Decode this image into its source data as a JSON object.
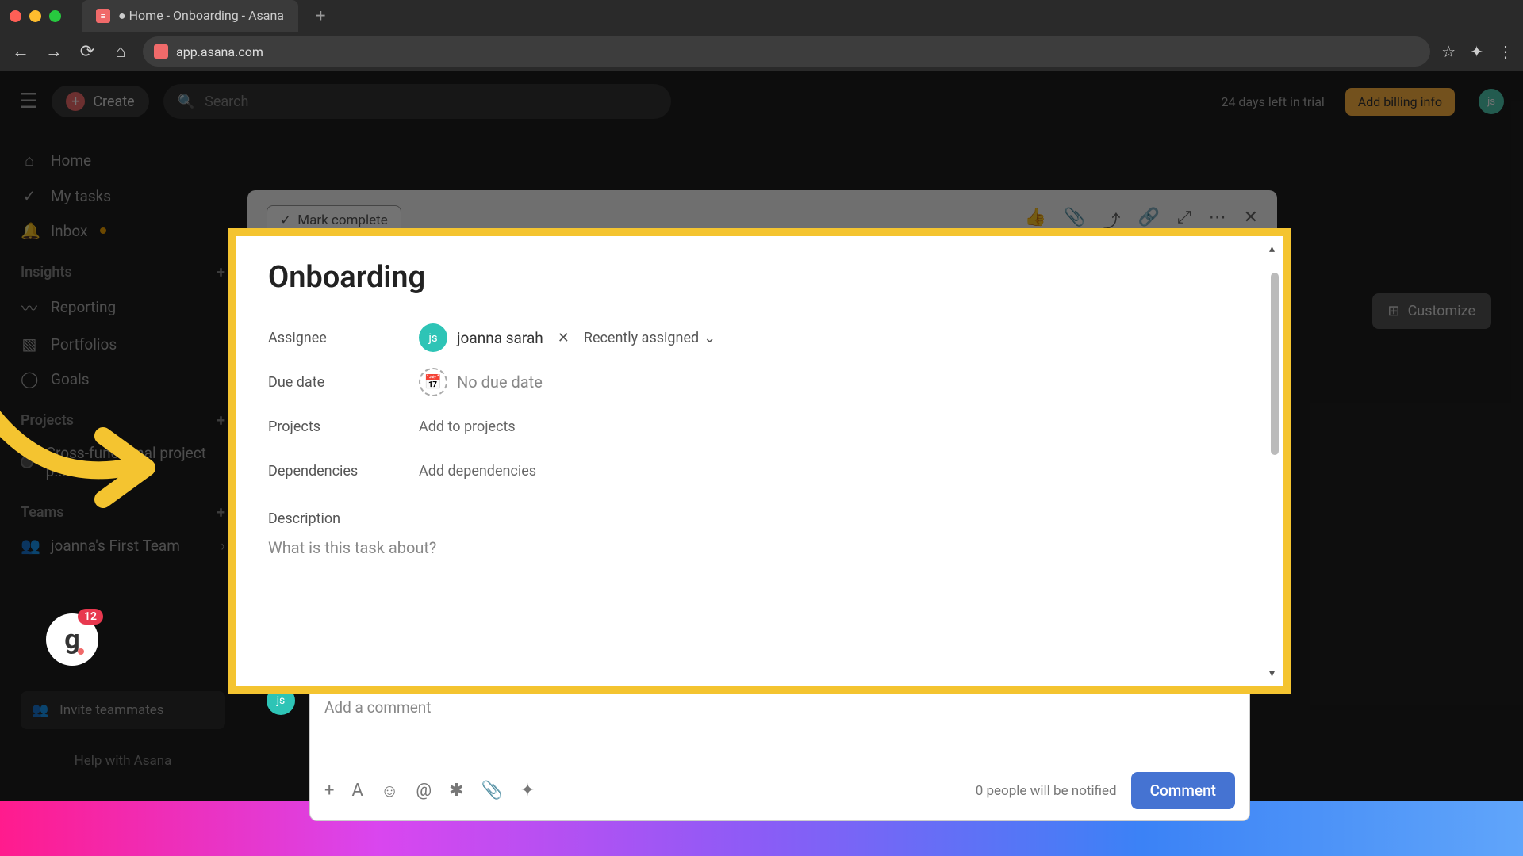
{
  "browser": {
    "tab_title": "● Home - Onboarding - Asana",
    "url": "app.asana.com"
  },
  "topbar": {
    "create": "Create",
    "search_placeholder": "Search",
    "trial": "24 days left in trial",
    "billing": "Add billing info"
  },
  "sidebar": {
    "home": "Home",
    "mytasks": "My tasks",
    "inbox": "Inbox",
    "insights": "Insights",
    "reporting": "Reporting",
    "portfolios": "Portfolios",
    "goals": "Goals",
    "projects_header": "Projects",
    "project1": "Cross-functional project p...",
    "teams_header": "Teams",
    "team1": "joanna's First Team",
    "invite": "Invite teammates",
    "help": "Help with Asana",
    "g_badge_count": "12"
  },
  "customize": "Customize",
  "task_panel": {
    "mark_complete": "Mark complete"
  },
  "modal": {
    "title": "Onboarding",
    "assignee_label": "Assignee",
    "assignee_initials": "js",
    "assignee_name": "joanna sarah",
    "recently_assigned": "Recently assigned",
    "due_label": "Due date",
    "due_text": "No due date",
    "projects_label": "Projects",
    "add_projects": "Add to projects",
    "dependencies_label": "Dependencies",
    "add_dependencies": "Add dependencies",
    "description_label": "Description",
    "description_placeholder": "What is this task about?"
  },
  "comment": {
    "avatar_initials": "js",
    "placeholder": "Add a comment",
    "notify": "0 people will be notified",
    "button": "Comment"
  }
}
